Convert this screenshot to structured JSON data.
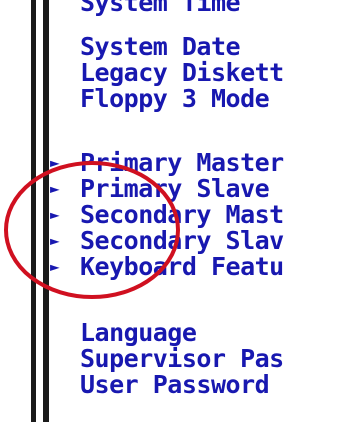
{
  "bios_menu": {
    "items": [
      {
        "label": "System Time",
        "submenu": false
      },
      {
        "label": "System Date",
        "submenu": false
      },
      {
        "label": "Legacy Diskett",
        "submenu": false
      },
      {
        "label": "Floppy 3 Mode",
        "submenu": false
      },
      {
        "label": "Primary Master",
        "submenu": true,
        "arrow": "►"
      },
      {
        "label": "Primary Slave",
        "submenu": true,
        "arrow": "►"
      },
      {
        "label": "Secondary Mast",
        "submenu": true,
        "arrow": "►"
      },
      {
        "label": "Secondary Slav",
        "submenu": true,
        "arrow": "►"
      },
      {
        "label": "Keyboard Featu",
        "submenu": true,
        "arrow": "►"
      },
      {
        "label": "Language",
        "submenu": false
      },
      {
        "label": "Supervisor Pas",
        "submenu": false
      },
      {
        "label": "User Password",
        "submenu": false
      }
    ]
  },
  "colors": {
    "menu_text": "#1818b0",
    "border": "#1a1a1a",
    "annotation_circle": "#d01020",
    "background": "#ffffff"
  },
  "annotation": {
    "shape": "circle-highlight",
    "highlights": "submenu-arrows"
  }
}
